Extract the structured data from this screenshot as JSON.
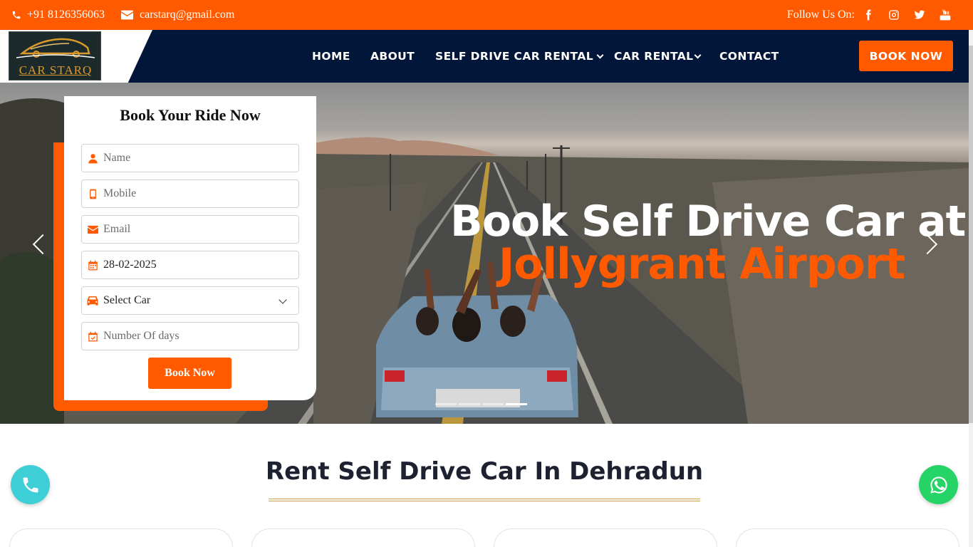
{
  "topbar": {
    "phone": "+91 8126356063",
    "email": "carstarq@gmail.com",
    "follow_label": "Follow Us On:",
    "social_icons": [
      "facebook-icon",
      "instagram-icon",
      "twitter-icon",
      "youtube-icon"
    ]
  },
  "nav": {
    "logo_text": "CAR STARQ",
    "items": [
      {
        "label": "HOME"
      },
      {
        "label": "ABOUT"
      },
      {
        "label": "SELF DRIVE CAR RENTAL"
      },
      {
        "label": "CAR RENTAL"
      },
      {
        "label": "CONTACT"
      }
    ],
    "cta": "BOOK NOW"
  },
  "hero": {
    "title_line1": "Book Self Drive Car at",
    "title_line2": "Jollygrant Airport",
    "slide_count": 4,
    "active_slide": 4
  },
  "form": {
    "title": "Book Your Ride Now",
    "name_placeholder": "Name",
    "mobile_placeholder": "Mobile",
    "email_placeholder": "Email",
    "date_value": "28-02-2025",
    "car_select": "Select Car",
    "days_placeholder": "Number Of days",
    "submit": "Book Now"
  },
  "section": {
    "title": "Rent Self Drive Car In Dehradun"
  },
  "colors": {
    "accent": "#ff5a00",
    "navy": "#02163a",
    "call_fab": "#3ecfd6",
    "whatsapp_fab": "#25d366"
  }
}
